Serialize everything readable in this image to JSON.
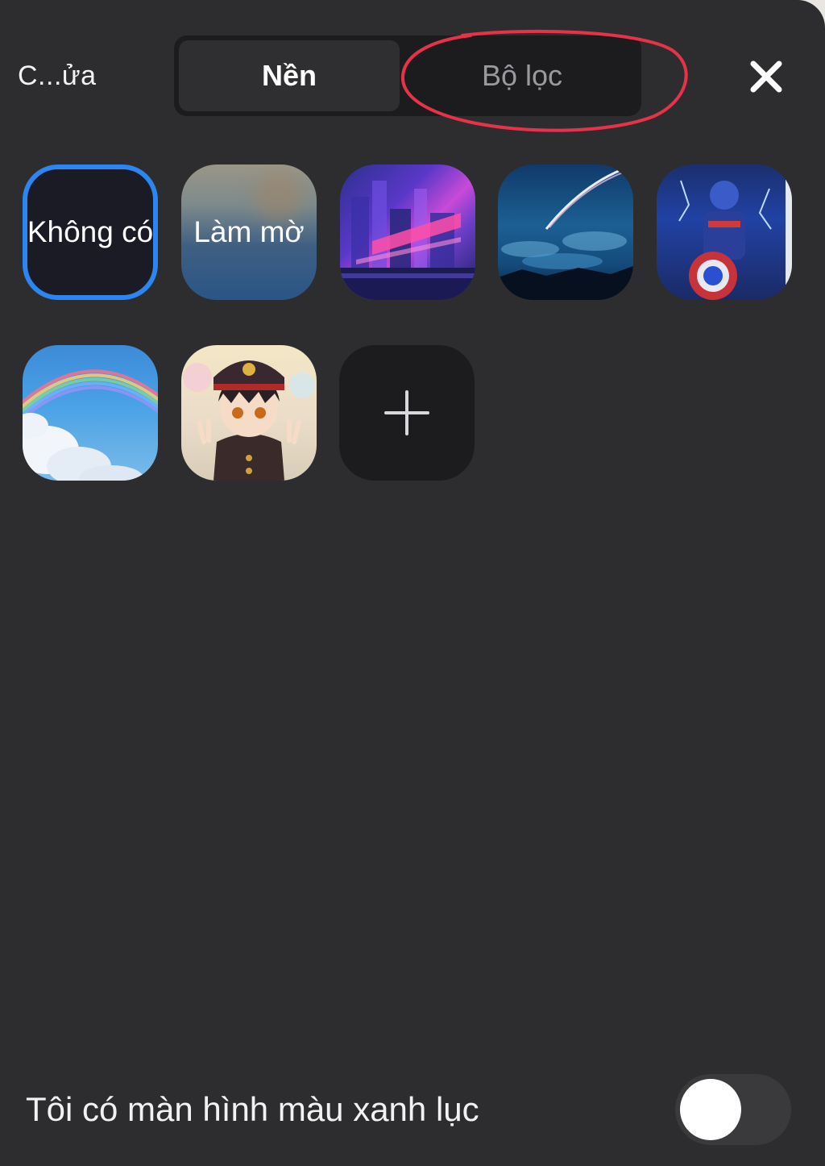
{
  "header": {
    "left_label": "C...ửa",
    "tabs": [
      {
        "label": "Nền",
        "selected": true
      },
      {
        "label": "Bộ lọc",
        "selected": false
      }
    ],
    "close_icon": "close-icon"
  },
  "backgrounds": {
    "items": [
      {
        "label": "Không có",
        "kind": "none",
        "selected": true
      },
      {
        "label": "Làm mờ",
        "kind": "blur",
        "selected": false
      },
      {
        "kind": "image",
        "subject": "neon city night"
      },
      {
        "kind": "image",
        "subject": "night sky with comet"
      },
      {
        "kind": "image",
        "subject": "superhero with shield"
      },
      {
        "kind": "image",
        "subject": "rainbow over clouds"
      },
      {
        "kind": "image",
        "subject": "anime boy with cap"
      }
    ],
    "add_icon": "plus-icon"
  },
  "footer": {
    "green_screen_label": "Tôi có màn hình màu xanh lục",
    "green_screen_enabled": false
  },
  "colors": {
    "panel": "#2d2d2f",
    "selection_border": "#2b86f2",
    "annotation": "#e8324a"
  }
}
